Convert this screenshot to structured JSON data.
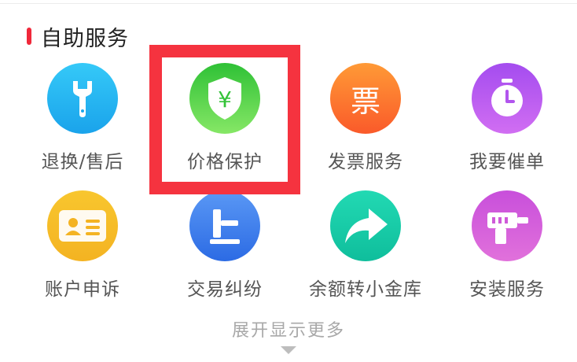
{
  "section": {
    "title": "自助服务"
  },
  "items": [
    {
      "label": "退换/售后",
      "icon": "wrench-icon",
      "color_top": "#2ec2f6",
      "color_bottom": "#1aa7ec"
    },
    {
      "label": "价格保护",
      "icon": "price-protect-shield-icon",
      "color_top": "#35c83a",
      "color_bottom": "#7be35f"
    },
    {
      "label": "发票服务",
      "icon": "invoice-icon",
      "color_top": "#ff9434",
      "color_bottom": "#fb5c2b",
      "icon_text": "票"
    },
    {
      "label": "我要催单",
      "icon": "stopwatch-icon",
      "color_top": "#a74ef0",
      "color_bottom": "#cf6cf1"
    },
    {
      "label": "账户申诉",
      "icon": "id-card-icon",
      "color_top": "#f7c32b",
      "color_bottom": "#f5b624"
    },
    {
      "label": "交易纠纷",
      "icon": "gavel-icon",
      "color_top": "#4f8ff2",
      "color_bottom": "#2e6fe5"
    },
    {
      "label": "余额转小金库",
      "icon": "share-arrow-icon",
      "color_top": "#20d7b0",
      "color_bottom": "#0fbf9d"
    },
    {
      "label": "安装服务",
      "icon": "drill-icon",
      "color_top": "#c94fdc",
      "color_bottom": "#e06fd9"
    }
  ],
  "highlight": {
    "color": "#f5333f",
    "target": "价格保护"
  },
  "expand": {
    "label": "展开显示更多"
  }
}
